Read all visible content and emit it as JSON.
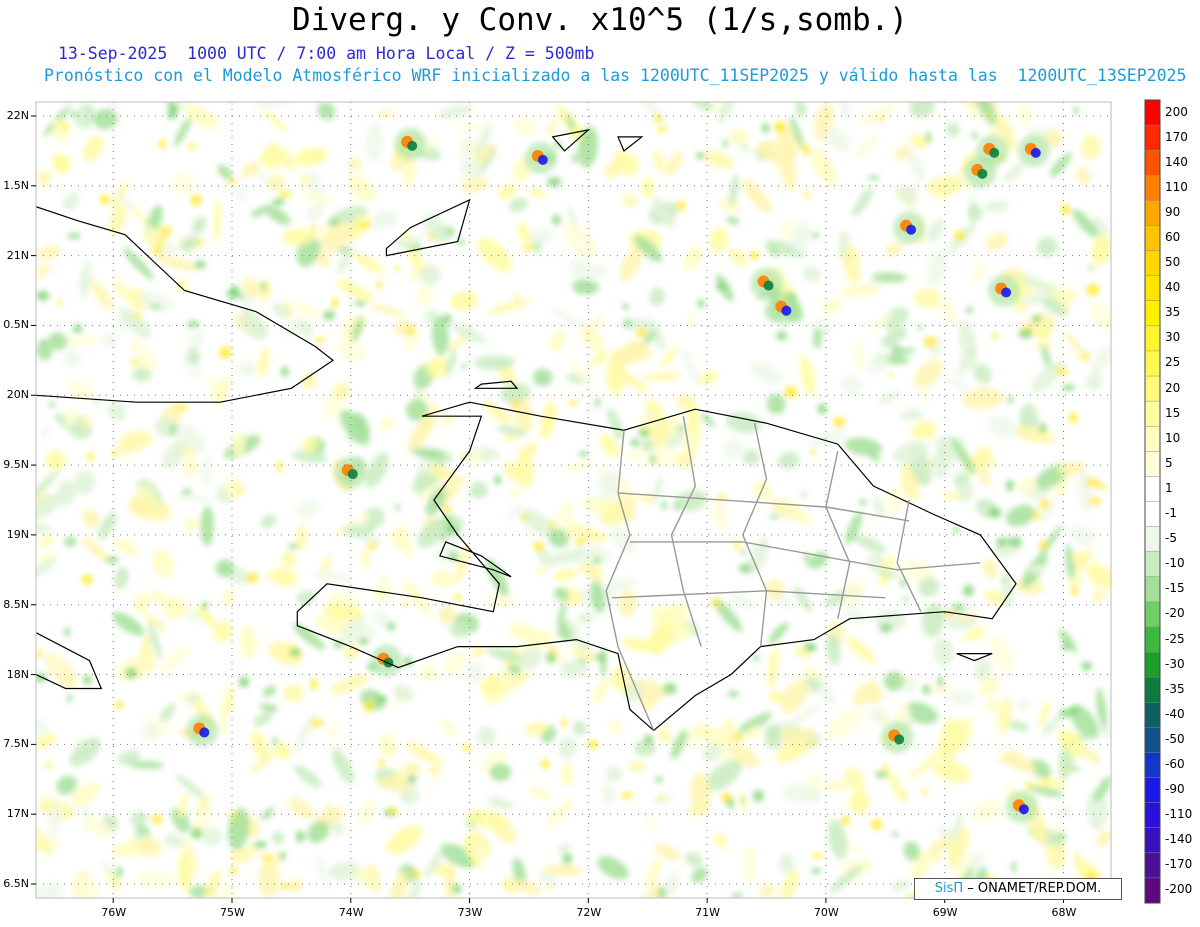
{
  "title": "Diverg. y Conv. x10^5 (1/s,somb.)",
  "subtitle_line1": "13-Sep-2025  1000 UTC / 7:00 am Hora Local / Z = 500mb",
  "subtitle_line2": "Pronóstico con el Modelo Atmosférico WRF inicializado a las 1200UTC_11SEP2025 y válido hasta las  1200UTC_13SEP2025",
  "credit": {
    "brand": "SisΠ",
    "text": " – ONAMET/REP.DOM."
  },
  "map": {
    "lon_range": [
      -76.65,
      -67.6
    ],
    "lat_range": [
      16.4,
      22.1
    ],
    "lat_labels": [
      "22N",
      "1.5N",
      "21N",
      "0.5N",
      "20N",
      "9.5N",
      "19N",
      "8.5N",
      "18N",
      "7.5N",
      "17N",
      "6.5N"
    ],
    "lon_labels": [
      "76W",
      "75W",
      "74W",
      "73W",
      "72W",
      "71W",
      "70W",
      "69W",
      "68W"
    ]
  },
  "colorbar": {
    "labels": [
      "200",
      "170",
      "140",
      "110",
      "90",
      "60",
      "50",
      "40",
      "35",
      "30",
      "25",
      "20",
      "15",
      "10",
      "5",
      "1",
      "-1",
      "-5",
      "-10",
      "-15",
      "-20",
      "-25",
      "-30",
      "-35",
      "-40",
      "-50",
      "-60",
      "-90",
      "-110",
      "-140",
      "-170",
      "-200"
    ],
    "colors": [
      "#ff0000",
      "#ff2a00",
      "#ff5500",
      "#ff7f00",
      "#ffa600",
      "#ffc400",
      "#ffd700",
      "#ffe500",
      "#fff000",
      "#fff52c",
      "#fff853",
      "#fffb7a",
      "#fffca0",
      "#fffdc0",
      "#fffed8",
      "#ffffff",
      "#ffffff",
      "#eef8ea",
      "#c8ecc0",
      "#a4e09a",
      "#6fcf66",
      "#3cba3c",
      "#1a9f2a",
      "#0c7d3e",
      "#0e6060",
      "#12508c",
      "#1236c8",
      "#1a1ae6",
      "#2a10d8",
      "#3a10b8",
      "#4a1098",
      "#5a0a7e"
    ]
  }
}
